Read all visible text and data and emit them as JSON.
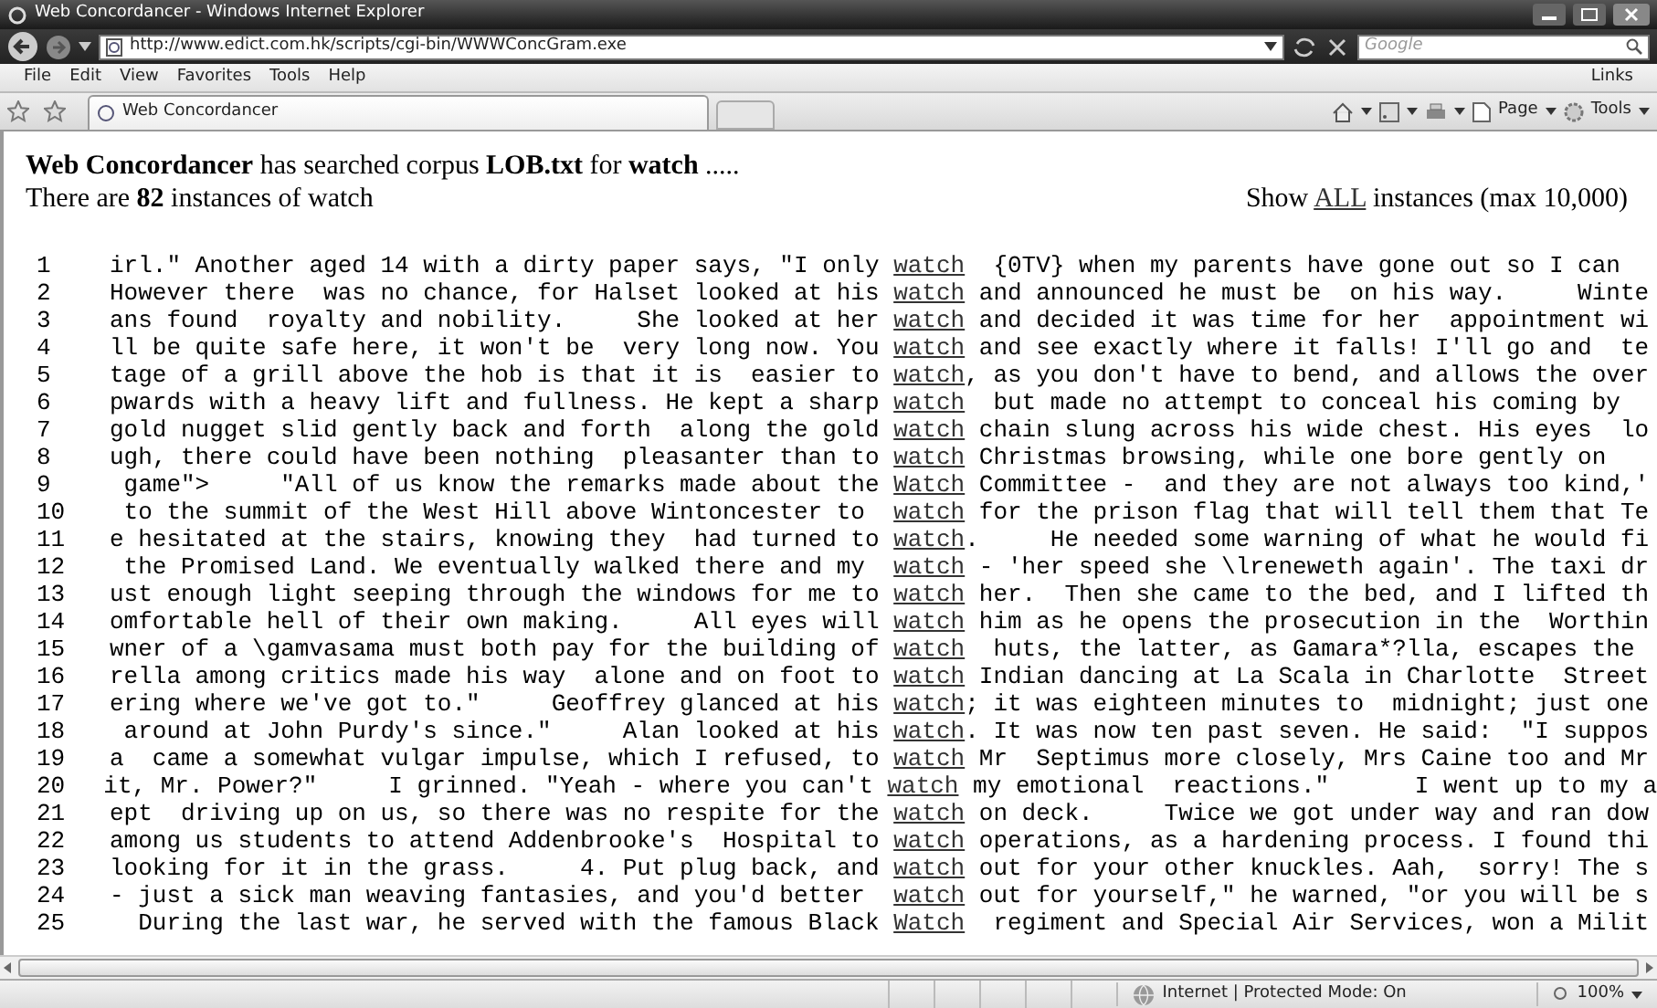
{
  "window": {
    "title": "Web Concordancer - Windows Internet Explorer"
  },
  "address_bar": {
    "url": "http://www.edict.com.hk/scripts/cgi-bin/WWWConcGram.exe"
  },
  "search": {
    "placeholder": "Google"
  },
  "menu": [
    "File",
    "Edit",
    "View",
    "Favorites",
    "Tools",
    "Help"
  ],
  "links_label": "Links",
  "tabs": [
    {
      "label": "Web Concordancer",
      "selected": true
    }
  ],
  "command_bar": [
    "Page",
    "Tools"
  ],
  "page": {
    "heading": "**Web Concordancer** has searched corpus **LOB.txt** for **watch** .....",
    "summary": "There are **82** instances of watch",
    "show_all": {
      "before": "Show",
      "link": "ALL",
      "after": "instances (max 10,000)"
    },
    "lines": [
      {
        "number": "1",
        "left": "irl.\" Another aged 14 with a dirty paper says, \"I only ",
        "keyword": "watch",
        "right": "  {0TV} when my parents have gone out so I can"
      },
      {
        "number": "2",
        "left": "However there  was no chance, for Halset looked at his ",
        "keyword": "watch",
        "right": " and announced he must be  on his way.     Winte"
      },
      {
        "number": "3",
        "left": "ans found  royalty and nobility.     She looked at her ",
        "keyword": "watch",
        "right": " and decided it was time for her  appointment wi"
      },
      {
        "number": "4",
        "left": "ll be quite safe here, it won't be  very long now. You ",
        "keyword": "watch",
        "right": " and see exactly where it falls! I'll go and  te"
      },
      {
        "number": "5",
        "left": "tage of a grill above the hob is that it is  easier to ",
        "keyword": "watch",
        "right": ", as you don't have to bend, and allows the over"
      },
      {
        "number": "6",
        "left": "pwards with a heavy lift and fullness. He kept a sharp ",
        "keyword": "watch",
        "right": "  but made no attempt to conceal his coming by"
      },
      {
        "number": "7",
        "left": "gold nugget slid gently back and forth  along the gold ",
        "keyword": "watch",
        "right": " chain slung across his wide chest. His eyes  lo"
      },
      {
        "number": "8",
        "left": "ugh, there could have been nothing  pleasanter than to ",
        "keyword": "watch",
        "right": " Christmas browsing, while one bore gently on"
      },
      {
        "number": "9",
        "left": " game\">     \"All of us know the remarks made about the ",
        "keyword": "Watch",
        "right": " Committee -  and they are not always too kind,'"
      },
      {
        "number": "10",
        "left": " to the summit of the West Hill above Wintoncester to  ",
        "keyword": "watch",
        "right": " for the prison flag that will tell them that Te"
      },
      {
        "number": "11",
        "left": "e hesitated at the stairs, knowing they  had turned to ",
        "keyword": "watch",
        "right": ".     He needed some warning of what he would fi"
      },
      {
        "number": "12",
        "left": " the Promised Land. We eventually walked there and my  ",
        "keyword": "watch",
        "right": " - 'her speed she \\lreneweth again'. The taxi dr"
      },
      {
        "number": "13",
        "left": "ust enough light seeping through the windows for me to ",
        "keyword": "watch",
        "right": " her.  Then she came to the bed, and I lifted th"
      },
      {
        "number": "14",
        "left": "omfortable hell of their own making.     All eyes will ",
        "keyword": "watch",
        "right": " him as he opens the prosecution in the  Worthin"
      },
      {
        "number": "15",
        "left": "wner of a \\gamvasama must both pay for the building of ",
        "keyword": "watch",
        "right": "  huts, the latter, as Gamara*?lla, escapes the"
      },
      {
        "number": "16",
        "left": "rella among critics made his way  alone and on foot to ",
        "keyword": "watch",
        "right": " Indian dancing at La Scala in Charlotte  Street"
      },
      {
        "number": "17",
        "left": "ering where we've got to.\"     Geoffrey glanced at his ",
        "keyword": "watch",
        "right": "; it was eighteen minutes to  midnight; just one"
      },
      {
        "number": "18",
        "left": " around at John Purdy's since.\"     Alan looked at his ",
        "keyword": "watch",
        "right": ". It was now ten past seven. He said:  \"I suppos"
      },
      {
        "number": "19",
        "left": "a  came a somewhat vulgar impulse, which I refused, to ",
        "keyword": "watch",
        "right": " Mr  Septimus more closely, Mrs Caine too and Mr"
      },
      {
        "number": "20",
        "left": "it, Mr. Power?\"     I grinned. \"Yeah - where you can't ",
        "keyword": "watch",
        "right": " my emotional  reactions.\"      I went up to my a"
      },
      {
        "number": "21",
        "left": "ept  driving up on us, so there was no respite for the ",
        "keyword": "watch",
        "right": " on deck.     Twice we got under way and ran dow"
      },
      {
        "number": "22",
        "left": "among us students to attend Addenbrooke's  Hospital to ",
        "keyword": "watch",
        "right": " operations, as a hardening process. I found thi"
      },
      {
        "number": "23",
        "left": "looking for it in the grass.     4. Put plug back, and ",
        "keyword": "watch",
        "right": " out for your other knuckles. Aah,  sorry! The s"
      },
      {
        "number": "24",
        "left": "- just a sick man weaving fantasies, and you'd better  ",
        "keyword": "watch",
        "right": " out for yourself,\" he warned, \"or you will be s"
      },
      {
        "number": "25",
        "left": "  During the last war, he served with the famous Black ",
        "keyword": "Watch",
        "right": "  regiment and Special Air Services, won a Milit"
      }
    ]
  },
  "status_bar": {
    "zone": "Internet | Protected Mode: On",
    "zoom": "100%"
  }
}
